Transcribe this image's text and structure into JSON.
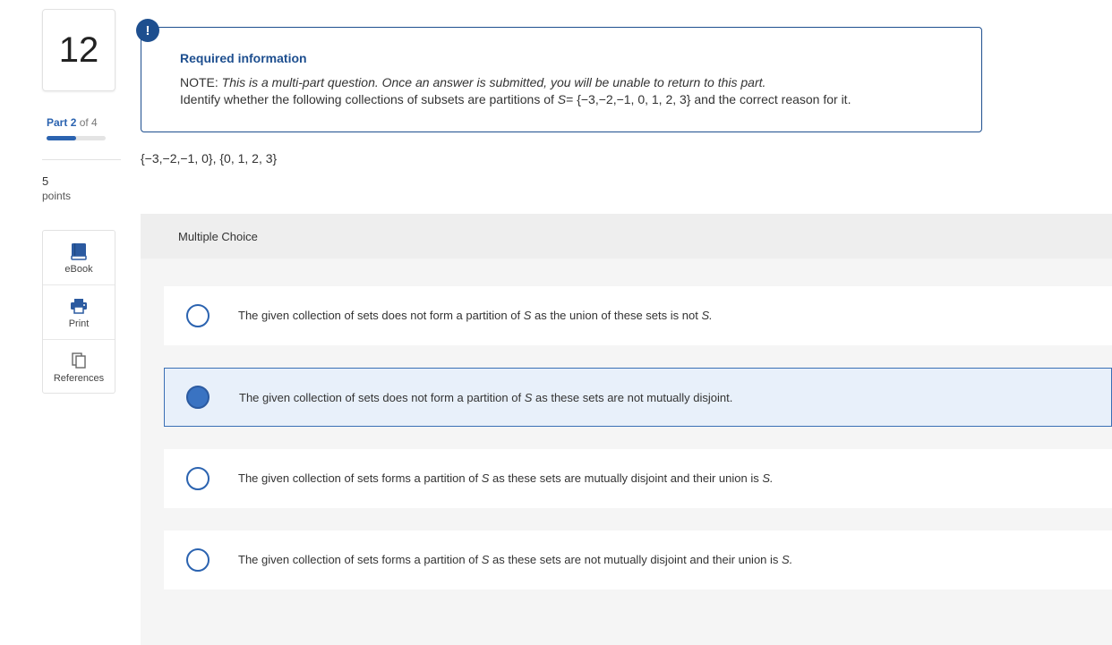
{
  "question": {
    "number": "12",
    "part_label": "Part",
    "part_current": "2",
    "part_of": "of 4",
    "part_progress": 0.5,
    "points_value": "5",
    "points_label": "points"
  },
  "tools": [
    {
      "label": "eBook",
      "icon": "book-icon"
    },
    {
      "label": "Print",
      "icon": "printer-icon"
    },
    {
      "label": "References",
      "icon": "references-icon"
    }
  ],
  "required_info": {
    "badge": "!",
    "title": "Required information",
    "note_prefix": "NOTE:",
    "note_text": "This is a multi-part question. Once an answer is submitted, you will be unable to return to this part.",
    "instruction_before": "Identify whether the following collections of subsets are partitions of",
    "set_variable": "S",
    "set_value": "= {−3,−2,−1, 0, 1, 2, 3}",
    "instruction_after": "and the correct reason for it."
  },
  "subsets": "{−3,−2,−1, 0}, {0, 1, 2, 3}",
  "multiple_choice": {
    "header": "Multiple Choice",
    "selected_index": 1,
    "options": [
      {
        "pre": "The given collection of sets does not form a partition of",
        "var": "S",
        "mid": "as the union of these sets is not",
        "end": "S."
      },
      {
        "pre": "The given collection of sets does not form a partition of",
        "var": "S",
        "mid": "as these sets are not mutually disjoint.",
        "end": ""
      },
      {
        "pre": "The given collection of sets forms a partition of",
        "var": "S",
        "mid": "as these sets are mutually disjoint and their union is",
        "end": "S."
      },
      {
        "pre": "The given collection of sets forms a partition of",
        "var": "S",
        "mid": "as these sets are not mutually disjoint and their union is",
        "end": "S."
      }
    ]
  },
  "colors": {
    "accent": "#1e4f8f",
    "radio": "#2b63b0",
    "selected_bg": "#e8f0fa"
  }
}
